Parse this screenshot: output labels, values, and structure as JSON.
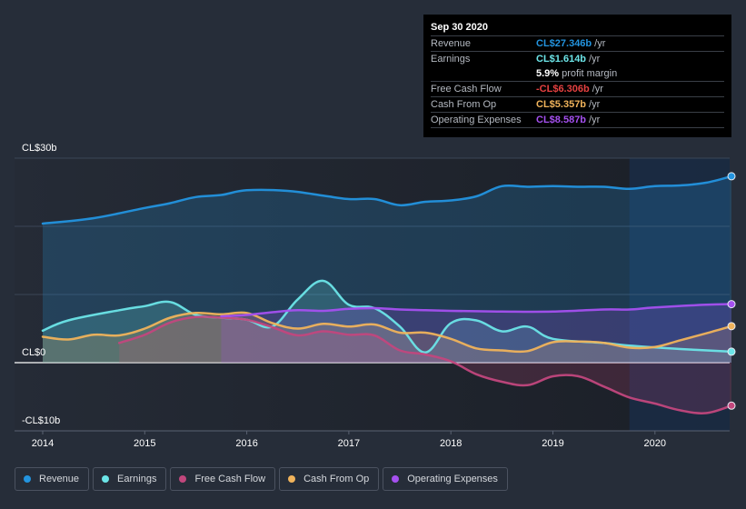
{
  "tooltip": {
    "date": "Sep 30 2020",
    "rows": [
      {
        "label": "Revenue",
        "value": "CL$27.346b",
        "unit": "/yr",
        "color": "#2394df"
      },
      {
        "label": "Earnings",
        "value": "CL$1.614b",
        "unit": "/yr",
        "color": "#6ce5e8"
      },
      {
        "label": "",
        "value": "5.9%",
        "unit": "profit margin",
        "color": "#ffffff"
      },
      {
        "label": "Free Cash Flow",
        "value": "-CL$6.306b",
        "unit": "/yr",
        "color": "#e64141"
      },
      {
        "label": "Cash From Op",
        "value": "CL$5.357b",
        "unit": "/yr",
        "color": "#f0b35b"
      },
      {
        "label": "Operating Expenses",
        "value": "CL$8.587b",
        "unit": "/yr",
        "color": "#a550f0"
      }
    ]
  },
  "legend": [
    {
      "label": "Revenue",
      "color": "#2394df"
    },
    {
      "label": "Earnings",
      "color": "#6ce5e8"
    },
    {
      "label": "Free Cash Flow",
      "color": "#c2477d"
    },
    {
      "label": "Cash From Op",
      "color": "#f0b35b"
    },
    {
      "label": "Operating Expenses",
      "color": "#a550f0"
    }
  ],
  "chart_data": {
    "type": "area",
    "title": "",
    "xlabel": "",
    "ylabel": "",
    "ylim": [
      -10,
      30
    ],
    "xlim": [
      2013.9,
      2020.75
    ],
    "y_ticks": [
      {
        "value": 30,
        "label": "CL$30b"
      },
      {
        "value": 0,
        "label": "CL$0"
      },
      {
        "value": -10,
        "label": "-CL$10b"
      }
    ],
    "gridlines": [
      30,
      20,
      10,
      0
    ],
    "x_ticks": [
      {
        "value": 2014,
        "label": "2014"
      },
      {
        "value": 2015,
        "label": "2015"
      },
      {
        "value": 2016,
        "label": "2016"
      },
      {
        "value": 2017,
        "label": "2017"
      },
      {
        "value": 2018,
        "label": "2018"
      },
      {
        "value": 2019,
        "label": "2019"
      },
      {
        "value": 2020,
        "label": "2020"
      }
    ],
    "highlight_from": 2019.75,
    "units": "CLP billions",
    "legend_position": "bottom",
    "series": [
      {
        "name": "Revenue",
        "color": "#2394df",
        "fill": "#2394df",
        "points": [
          [
            2014,
            20.4
          ],
          [
            2014.5,
            21.2
          ],
          [
            2015,
            22.7
          ],
          [
            2015.25,
            23.4
          ],
          [
            2015.5,
            24.3
          ],
          [
            2015.75,
            24.6
          ],
          [
            2016,
            25.3
          ],
          [
            2016.4,
            25.2
          ],
          [
            2016.75,
            24.5
          ],
          [
            2017,
            24.0
          ],
          [
            2017.25,
            24.0
          ],
          [
            2017.5,
            23.1
          ],
          [
            2017.75,
            23.6
          ],
          [
            2018,
            23.8
          ],
          [
            2018.25,
            24.4
          ],
          [
            2018.5,
            25.9
          ],
          [
            2018.75,
            25.8
          ],
          [
            2019,
            25.9
          ],
          [
            2019.25,
            25.8
          ],
          [
            2019.5,
            25.8
          ],
          [
            2019.75,
            25.5
          ],
          [
            2020,
            25.9
          ],
          [
            2020.25,
            26.0
          ],
          [
            2020.5,
            26.4
          ],
          [
            2020.75,
            27.346
          ]
        ]
      },
      {
        "name": "Earnings",
        "color": "#6ce5e8",
        "fill": "#6ce5e8",
        "points": [
          [
            2014,
            4.7
          ],
          [
            2014.25,
            6.2
          ],
          [
            2014.75,
            7.7
          ],
          [
            2015,
            8.3
          ],
          [
            2015.25,
            8.9
          ],
          [
            2015.5,
            7.0
          ],
          [
            2015.75,
            6.6
          ],
          [
            2016,
            6.3
          ],
          [
            2016.25,
            5.3
          ],
          [
            2016.5,
            9.3
          ],
          [
            2016.75,
            12.0
          ],
          [
            2017,
            8.5
          ],
          [
            2017.25,
            8.0
          ],
          [
            2017.5,
            5.3
          ],
          [
            2017.75,
            1.5
          ],
          [
            2018,
            5.8
          ],
          [
            2018.25,
            6.2
          ],
          [
            2018.5,
            4.6
          ],
          [
            2018.75,
            5.3
          ],
          [
            2019,
            3.5
          ],
          [
            2019.5,
            2.9
          ],
          [
            2019.75,
            2.5
          ],
          [
            2020.25,
            2.0
          ],
          [
            2020.75,
            1.614
          ]
        ]
      },
      {
        "name": "Free Cash Flow",
        "color": "#c2477d",
        "fill": "#c2477d",
        "points": [
          [
            2014.75,
            2.9
          ],
          [
            2015,
            4.1
          ],
          [
            2015.25,
            5.9
          ],
          [
            2015.5,
            6.7
          ],
          [
            2015.75,
            6.6
          ],
          [
            2016,
            6.3
          ],
          [
            2016.25,
            5.2
          ],
          [
            2016.5,
            4.0
          ],
          [
            2016.75,
            4.6
          ],
          [
            2017,
            4.1
          ],
          [
            2017.25,
            4.0
          ],
          [
            2017.5,
            1.8
          ],
          [
            2017.75,
            1.2
          ],
          [
            2018,
            0.2
          ],
          [
            2018.25,
            -1.7
          ],
          [
            2018.5,
            -2.8
          ],
          [
            2018.75,
            -3.3
          ],
          [
            2019,
            -2.0
          ],
          [
            2019.25,
            -2.0
          ],
          [
            2019.5,
            -3.5
          ],
          [
            2019.75,
            -5.1
          ],
          [
            2020,
            -6.0
          ],
          [
            2020.25,
            -7.0
          ],
          [
            2020.5,
            -7.4
          ],
          [
            2020.75,
            -6.306
          ]
        ]
      },
      {
        "name": "Cash From Op",
        "color": "#f0b35b",
        "fill": "#f0b35b",
        "points": [
          [
            2014,
            3.8
          ],
          [
            2014.25,
            3.4
          ],
          [
            2014.5,
            4.1
          ],
          [
            2014.75,
            4.0
          ],
          [
            2015,
            5.0
          ],
          [
            2015.25,
            6.6
          ],
          [
            2015.5,
            7.3
          ],
          [
            2015.75,
            7.1
          ],
          [
            2016,
            7.3
          ],
          [
            2016.25,
            5.8
          ],
          [
            2016.5,
            5.0
          ],
          [
            2016.75,
            5.7
          ],
          [
            2017,
            5.3
          ],
          [
            2017.25,
            5.6
          ],
          [
            2017.5,
            4.4
          ],
          [
            2017.75,
            4.4
          ],
          [
            2018,
            3.5
          ],
          [
            2018.25,
            2.1
          ],
          [
            2018.5,
            1.8
          ],
          [
            2018.75,
            1.7
          ],
          [
            2019,
            3.0
          ],
          [
            2019.25,
            3.1
          ],
          [
            2019.5,
            2.9
          ],
          [
            2019.75,
            2.2
          ],
          [
            2020,
            2.3
          ],
          [
            2020.25,
            3.3
          ],
          [
            2020.5,
            4.3
          ],
          [
            2020.75,
            5.357
          ]
        ]
      },
      {
        "name": "Operating Expenses",
        "color": "#a550f0",
        "fill": "#a550f0",
        "points": [
          [
            2015.75,
            6.8
          ],
          [
            2016,
            7.0
          ],
          [
            2016.25,
            7.4
          ],
          [
            2016.5,
            7.7
          ],
          [
            2016.75,
            7.6
          ],
          [
            2017,
            7.9
          ],
          [
            2017.25,
            8.0
          ],
          [
            2017.5,
            7.8
          ],
          [
            2017.75,
            7.7
          ],
          [
            2018,
            7.6
          ],
          [
            2018.5,
            7.5
          ],
          [
            2019,
            7.5
          ],
          [
            2019.5,
            7.8
          ],
          [
            2019.75,
            7.8
          ],
          [
            2020,
            8.1
          ],
          [
            2020.5,
            8.5
          ],
          [
            2020.75,
            8.587
          ]
        ]
      }
    ]
  }
}
